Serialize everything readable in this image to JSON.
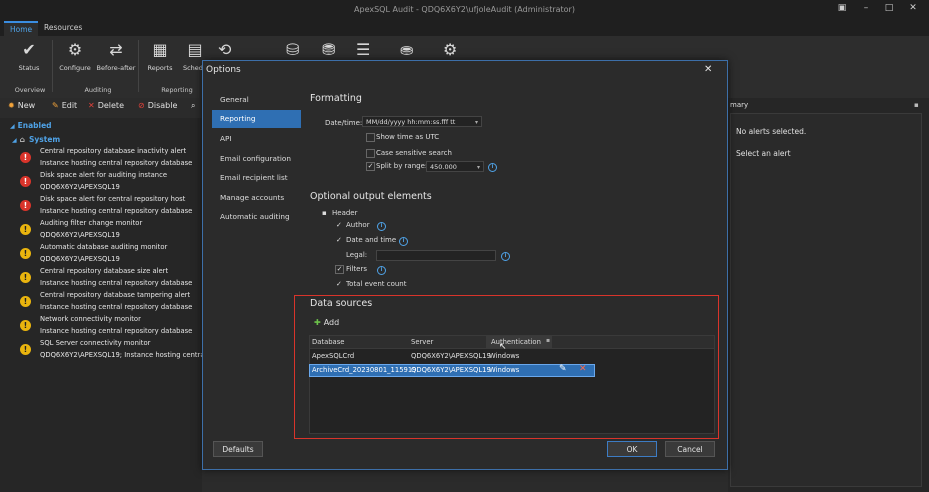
{
  "window": {
    "title": "ApexSQL Audit - QDQ6X6Y2\\ufjoleAudit (Administrator)"
  },
  "ribbon": {
    "tabs": [
      "Home",
      "Resources"
    ],
    "buttons": [
      {
        "label": "Status",
        "icon": "check-icon"
      },
      {
        "label": "Configure",
        "icon": "gear-db-icon"
      },
      {
        "label": "Before-after",
        "icon": "arrows-icon"
      },
      {
        "label": "Reports",
        "icon": "reports-icon"
      },
      {
        "label": "Schedu",
        "icon": "calendar-icon"
      }
    ],
    "groups": [
      "Overview",
      "Auditing",
      "Reporting"
    ]
  },
  "toolbar": {
    "new": "New",
    "edit": "Edit",
    "delete": "Delete",
    "disable": "Disable"
  },
  "tree": {
    "enabled_label": "Enabled",
    "system_label": "System",
    "alerts": [
      {
        "type": "err",
        "name": "Central repository database inactivity alert",
        "detail": "Instance hosting central repository database"
      },
      {
        "type": "err",
        "name": "Disk space alert for auditing instance",
        "detail": "QDQ6X6Y2\\APEXSQL19"
      },
      {
        "type": "err",
        "name": "Disk space alert for central repository host",
        "detail": "Instance hosting central repository database"
      },
      {
        "type": "warn",
        "name": "Auditing filter change monitor",
        "detail": "QDQ6X6Y2\\APEXSQL19"
      },
      {
        "type": "warn",
        "name": "Automatic database auditing monitor",
        "detail": "QDQ6X6Y2\\APEXSQL19"
      },
      {
        "type": "warn",
        "name": "Central repository database size alert",
        "detail": "Instance hosting central repository database"
      },
      {
        "type": "warn",
        "name": "Central repository database tampering alert",
        "detail": "Instance hosting central repository database"
      },
      {
        "type": "warn",
        "name": "Network connectivity monitor",
        "detail": "Instance hosting central repository database"
      },
      {
        "type": "warn",
        "name": "SQL Server connectivity monitor",
        "detail": "QDQ6X6Y2\\APEXSQL19; Instance hosting central rep"
      }
    ]
  },
  "summary": {
    "title": "mary",
    "no_alerts": "No alerts selected.",
    "select_alert": "Select an alert"
  },
  "dialog": {
    "title": "Options",
    "nav": [
      "General",
      "Reporting",
      "API",
      "Email configuration",
      "Email recipient list",
      "Manage accounts",
      "Automatic auditing"
    ],
    "active_nav": "Reporting",
    "formatting": {
      "title": "Formatting",
      "datetime_label": "Date/time:",
      "datetime_value": "MM/dd/yyyy hh:mm:ss.fff tt",
      "show_utc": "Show time as UTC",
      "case_sensitive": "Case sensitive search",
      "split_label": "Split by range:",
      "split_value": "450.000"
    },
    "optional": {
      "title": "Optional output elements",
      "header": "Header",
      "author": "Author",
      "date_time": "Date and time",
      "legal": "Legal:",
      "filters": "Filters",
      "total_event_count": "Total event count"
    },
    "data_sources": {
      "title": "Data sources",
      "add": "Add",
      "columns": [
        "Database",
        "Server",
        "Authentication"
      ],
      "rows": [
        {
          "database": "ApexSQLCrd",
          "server": "QDQ6X6Y2\\APEXSQL19",
          "auth": "Windows"
        },
        {
          "database": "ArchiveCrd_20230801_115919",
          "server": "QDQ6X6Y2\\APEXSQL19",
          "auth": "Windows"
        }
      ]
    },
    "buttons": {
      "defaults": "Defaults",
      "ok": "OK",
      "cancel": "Cancel"
    }
  },
  "colors": {
    "accent": "#2f6fb3",
    "error": "#d9342b",
    "warning": "#e9b40e",
    "highlight_border": "#d9342b"
  }
}
